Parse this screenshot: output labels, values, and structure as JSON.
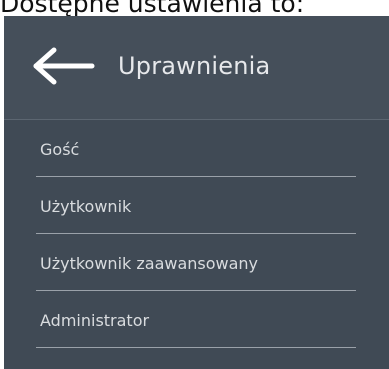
{
  "caption": "Dostępne ustawienia to:",
  "header": {
    "title": "Uprawnienia",
    "back_icon": "arrow-left-icon"
  },
  "options": [
    {
      "label": "Gość"
    },
    {
      "label": "Użytkownik"
    },
    {
      "label": "Użytkownik zaawansowany"
    },
    {
      "label": "Administrator"
    }
  ],
  "colors": {
    "panel_bg": "#404a55",
    "header_bg": "#454f5a",
    "text": "#d9dcdf",
    "divider": "#9aa1a9"
  }
}
